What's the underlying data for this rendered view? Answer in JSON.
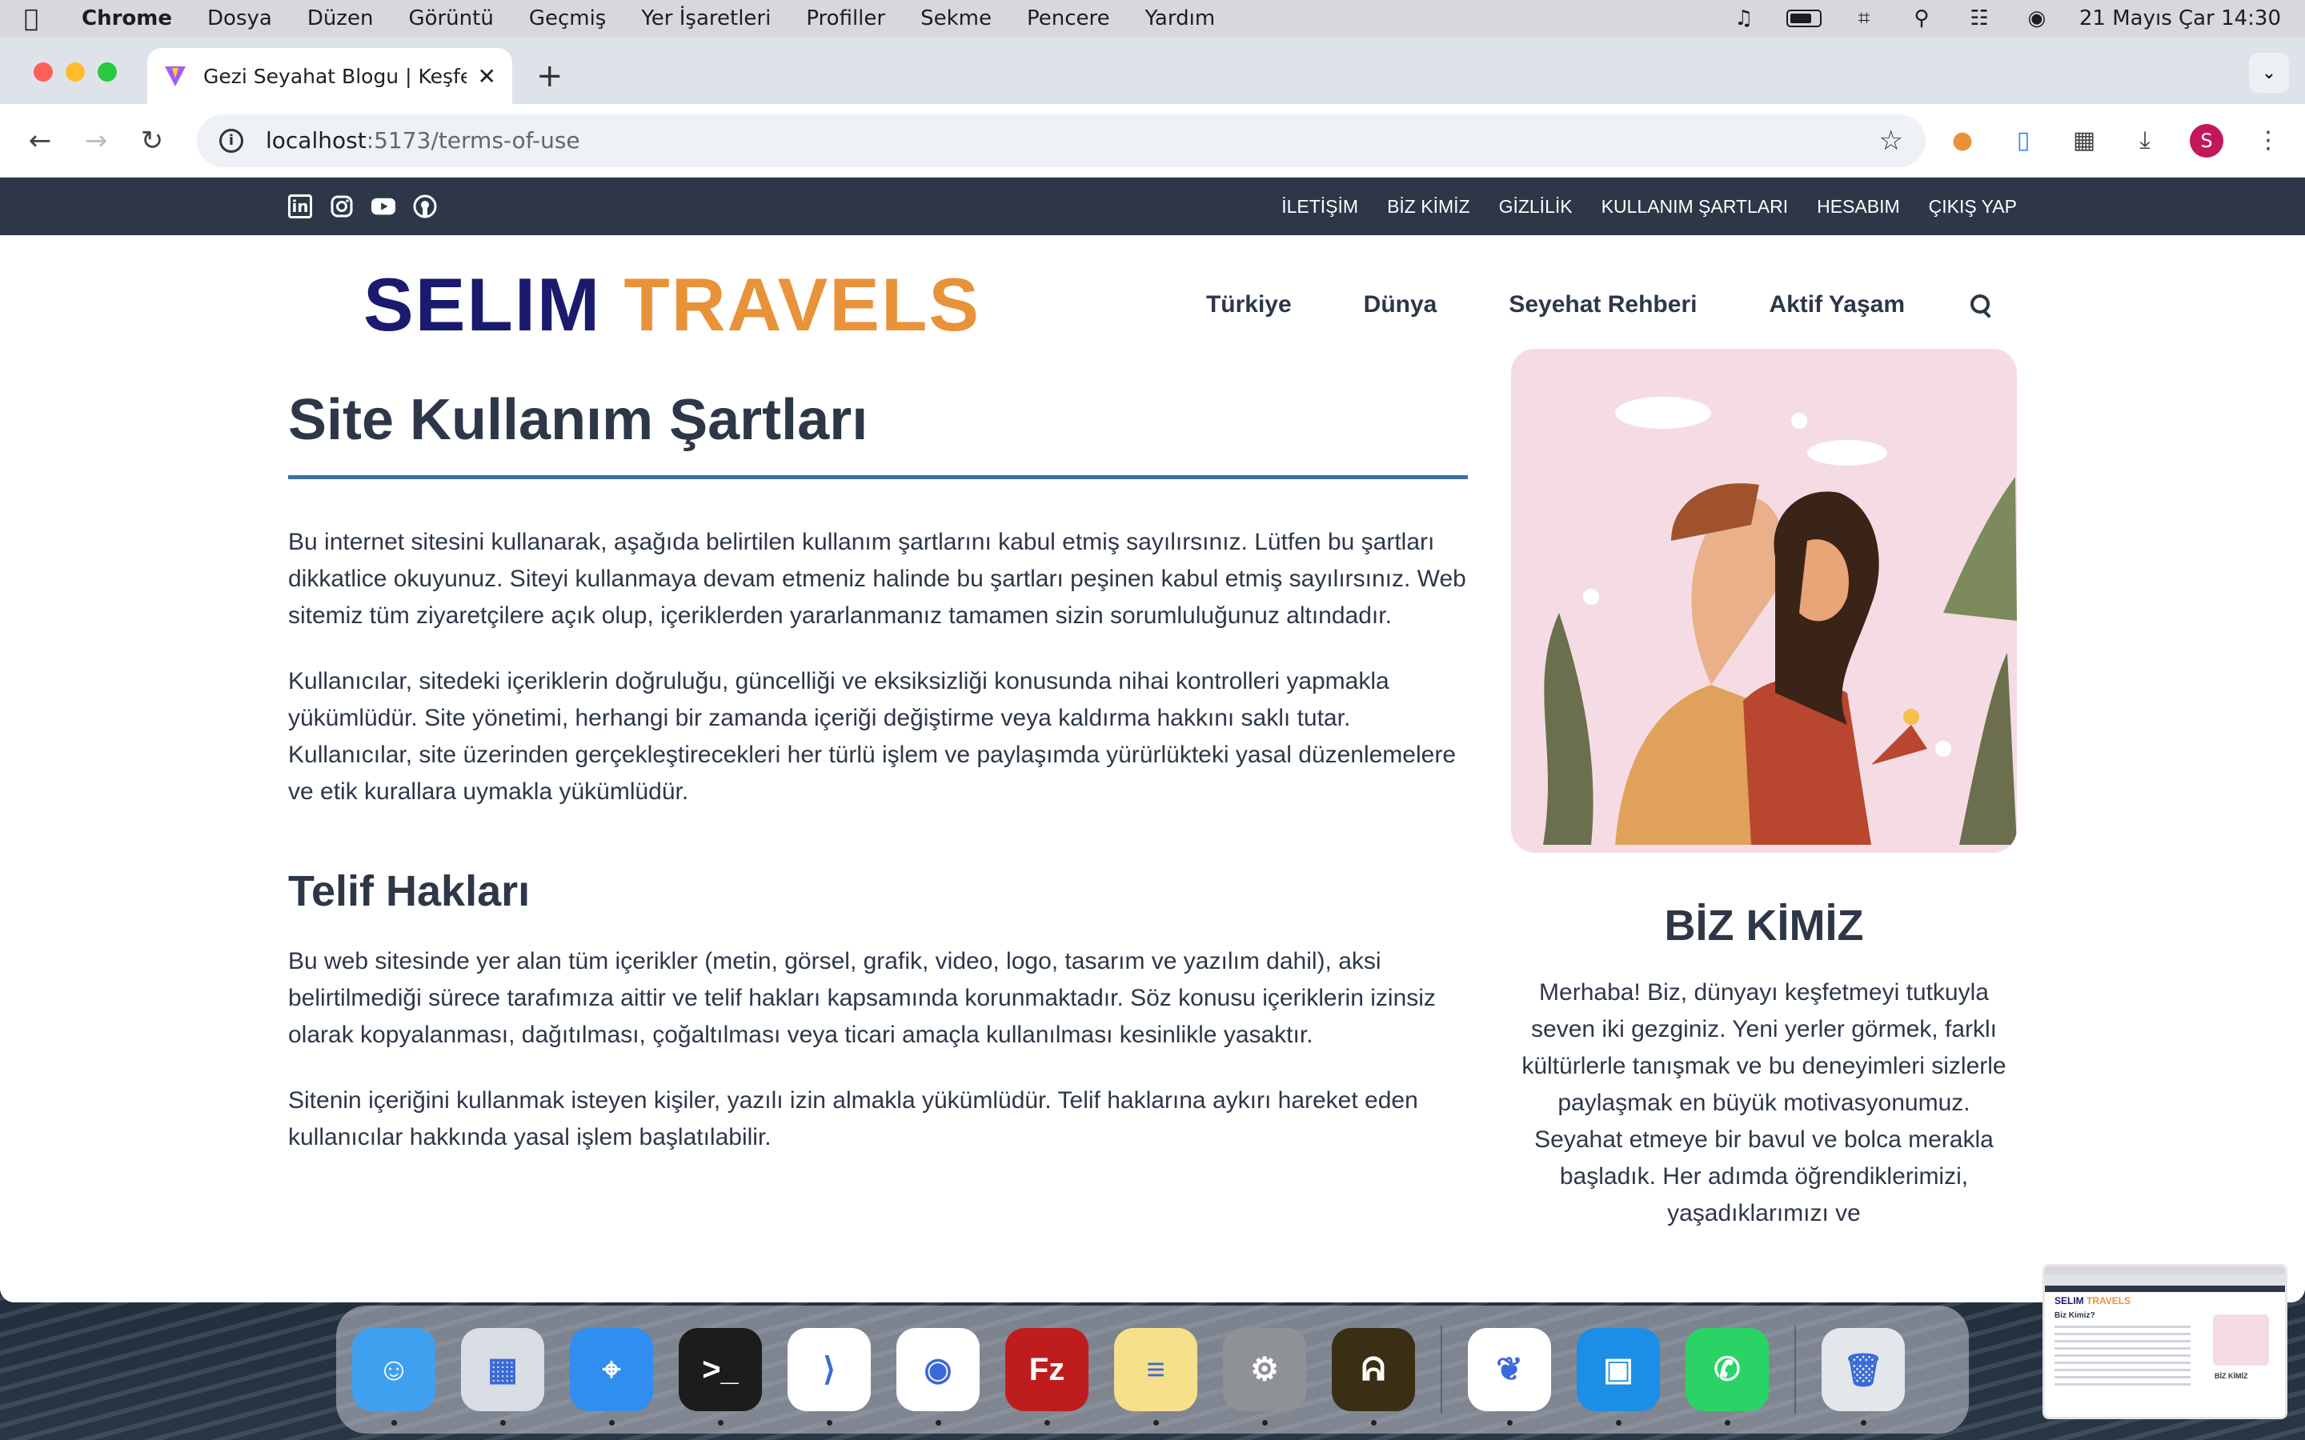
{
  "menubar": {
    "app": "Chrome",
    "items": [
      "Dosya",
      "Düzen",
      "Görüntü",
      "Geçmiş",
      "Yer İşaretleri",
      "Profiller",
      "Sekme",
      "Pencere",
      "Yardım"
    ],
    "datetime": "21 Mayıs Çar  14:30"
  },
  "browser": {
    "tab_title": "Gezi Seyahat Blogu | Keşfet, D",
    "url_host": "localhost",
    "url_rest": ":5173/terms-of-use",
    "profile_initial": "S"
  },
  "site": {
    "toplinks": [
      "İLETİŞİM",
      "BİZ KİMİZ",
      "GİZLİLİK",
      "KULLANIM ŞARTLARI",
      "HESABIM",
      "ÇIKIŞ YAP"
    ],
    "logo_part1": "SELIM",
    "logo_part2": "TRAVELS",
    "nav": [
      "Türkiye",
      "Dünya",
      "Seyehat Rehberi",
      "Aktif Yaşam"
    ]
  },
  "content": {
    "title": "Site Kullanım Şartları",
    "para1": "Bu internet sitesini kullanarak, aşağıda belirtilen kullanım şartlarını kabul etmiş sayılırsınız. Lütfen bu şartları dikkatlice okuyunuz. Siteyi kullanmaya devam etmeniz halinde bu şartları peşinen kabul etmiş sayılırsınız. Web sitemiz tüm ziyaretçilere açık olup, içeriklerden yararlanmanız tamamen sizin sorumluluğunuz altındadır.",
    "para2": "Kullanıcılar, sitedeki içeriklerin doğruluğu, güncelliği ve eksiksizliği konusunda nihai kontrolleri yapmakla yükümlüdür. Site yönetimi, herhangi bir zamanda içeriği değiştirme veya kaldırma hakkını saklı tutar. Kullanıcılar, site üzerinden gerçekleştirecekleri her türlü işlem ve paylaşımda yürürlükteki yasal düzenlemelere ve etik kurallara uymakla yükümlüdür.",
    "h2": "Telif Hakları",
    "para3": "Bu web sitesinde yer alan tüm içerikler (metin, görsel, grafik, video, logo, tasarım ve yazılım dahil), aksi belirtilmediği sürece tarafımıza aittir ve telif hakları kapsamında korunmaktadır. Söz konusu içeriklerin izinsiz olarak kopyalanması, dağıtılması, çoğaltılması veya ticari amaçla kullanılması kesinlikle yasaktır.",
    "para4": "Sitenin içeriğini kullanmak isteyen kişiler, yazılı izin almakla yükümlüdür. Telif haklarına aykırı hareket eden kullanıcılar hakkında yasal işlem başlatılabilir."
  },
  "sidebar": {
    "title": "BİZ KİMİZ",
    "text": "Merhaba! Biz, dünyayı keşfetmeyi tutkuyla seven iki gezginiz. Yeni yerler görmek, farklı kültürlerle tanışmak ve bu deneyimleri sizlerle paylaşmak en büyük motivasyonumuz. Seyahat etmeye bir bavul ve bolca merakla başladık. Her adımda öğrendiklerimizi, yaşadıklarımızı ve"
  },
  "dock": {
    "apps": [
      {
        "name": "Finder",
        "color": "#3fa0f0",
        "glyph": "☺"
      },
      {
        "name": "Launchpad",
        "color": "#d9dde4",
        "glyph": "▦"
      },
      {
        "name": "Safari",
        "color": "#2f8ef0",
        "glyph": "⌖"
      },
      {
        "name": "Terminal",
        "color": "#1c1c1c",
        "glyph": ">_"
      },
      {
        "name": "VS Code",
        "color": "#ffffff",
        "glyph": "⟩"
      },
      {
        "name": "Chrome",
        "color": "#ffffff",
        "glyph": "◉"
      },
      {
        "name": "FileZilla",
        "color": "#bf1d1d",
        "glyph": "Fz"
      },
      {
        "name": "Notes",
        "color": "#f7e08a",
        "glyph": "≡"
      },
      {
        "name": "System Settings",
        "color": "#8e9196",
        "glyph": "⚙"
      },
      {
        "name": "Navicat",
        "color": "#3a2f14",
        "glyph": "ᕱ"
      },
      {
        "name": "MongoDB Compass",
        "color": "#ffffff",
        "glyph": "❦"
      },
      {
        "name": "Docker",
        "color": "#1d8ee6",
        "glyph": "▣"
      },
      {
        "name": "WhatsApp",
        "color": "#2bd366",
        "glyph": "✆"
      },
      {
        "name": "Trash",
        "color": "#e3e6ea",
        "glyph": "🗑"
      }
    ]
  },
  "thumbnail": {
    "logo_part1": "SELIM",
    "logo_part2": "TRAVELS",
    "heading": "Biz Kimiz?",
    "side_title": "BİZ KİMİZ"
  }
}
